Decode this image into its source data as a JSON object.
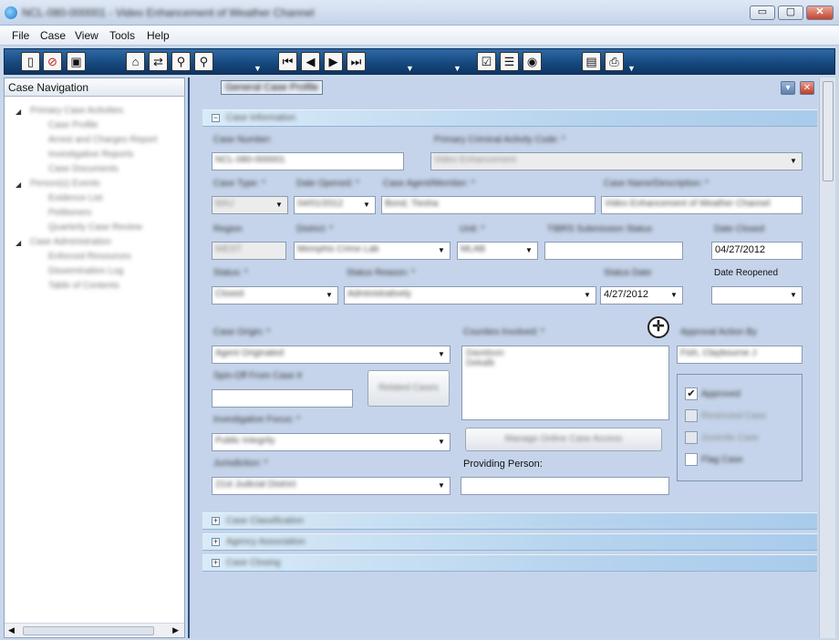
{
  "window": {
    "title": "NCL-080-000001 - Video Enhancement of Weather Channel",
    "buttons": {
      "minimize": "▭",
      "maximize": "▢",
      "close": "✕"
    }
  },
  "menu": {
    "file": "File",
    "case": "Case",
    "view": "View",
    "tools": "Tools",
    "help": "Help"
  },
  "toolbar": {
    "icons": [
      "new-document-icon",
      "stop-icon",
      "save-icon",
      "home-icon",
      "refresh-icon",
      "search-icon",
      "advanced-search-icon",
      "first-record-icon",
      "previous-record-icon",
      "next-record-icon",
      "last-record-icon",
      "checklist-icon",
      "notes-icon",
      "preview-icon",
      "report-icon",
      "print-icon"
    ]
  },
  "sidebar": {
    "title": "Case Navigation",
    "groups": [
      {
        "label": "Primary Case Activities",
        "children": [
          "Case Profile",
          "Arrest and Charges Report",
          "Investigative Reports",
          "Case Documents"
        ]
      },
      {
        "label": "Person(s) Events",
        "children": [
          "Evidence List",
          "Petitioners",
          "Quarterly Case Review"
        ]
      },
      {
        "label": "Case Administration",
        "children": [
          "Enforced Resources",
          "Dissemination Log",
          "Table of Contents"
        ]
      }
    ]
  },
  "panel": {
    "title": "General Case Profile"
  },
  "case_info": {
    "section_title": "Case Information",
    "case_number": {
      "label": "Case Number:",
      "value": "NCL-080-000001"
    },
    "primary_activity": {
      "label": "Primary Criminal Activity Code: *",
      "value": "Video Enhancement"
    },
    "case_type": {
      "label": "Case Type: *",
      "value": "MAJ"
    },
    "date_opened": {
      "label": "Date Opened: *",
      "value": "04/01/2012"
    },
    "case_agent": {
      "label": "Case Agent/Member: *",
      "value": "Bond, Tiesha"
    },
    "case_name": {
      "label": "Case Name/Description: *",
      "value": "Video Enhancement of Weather Channel"
    },
    "region": {
      "label": "Region",
      "value": "WEST"
    },
    "district": {
      "label": "District: *",
      "value": "Memphis Crime Lab"
    },
    "unit": {
      "label": "Unit: *",
      "value": "MLAB"
    },
    "tibrs": {
      "label": "TIBRS Submission Status",
      "value": ""
    },
    "date_closed": {
      "label": "Date Closed",
      "value": "04/27/2012"
    },
    "status": {
      "label": "Status: *",
      "value": "Closed"
    },
    "status_reason": {
      "label": "Status Reason: *",
      "value": "Administratively"
    },
    "status_date": {
      "label": "Status Date",
      "value": "4/27/2012"
    },
    "date_reopened": {
      "label": "Date Reopened",
      "value": ""
    },
    "case_origin": {
      "label": "Case Origin: *",
      "value": "Agent Originated"
    },
    "counties": {
      "label": "Counties Involved: *",
      "values": [
        "Davidson",
        "Dekalb"
      ]
    },
    "approval": {
      "label": "Approval Action By",
      "value": "Fish, Claybourne J"
    },
    "spin_off": {
      "label": "Spin-Off From Case #",
      "value": ""
    },
    "related_cases_button": "Related Cases",
    "focus": {
      "label": "Investigative Focus: *",
      "value": "Public Integrity"
    },
    "manage_access_button": "Manage Online Case Access",
    "jurisdiction": {
      "label": "Jurisdiction: *",
      "value": "21st Judicial District"
    },
    "providing_person": {
      "label": "Providing Person:",
      "value": ""
    },
    "checks": [
      {
        "label": "Approved",
        "checked": "✔"
      },
      {
        "label": "Restricted Case",
        "checked": ""
      },
      {
        "label": "Juvenile Case",
        "checked": ""
      },
      {
        "label": "Flag Case",
        "checked": ""
      }
    ]
  },
  "sections": {
    "classification": "Case Classification",
    "agency": "Agency Association",
    "closing": "Case Closing",
    "expand_symbol": "⊞",
    "collapse_symbol": "⊟"
  },
  "glyphs": {
    "dropdown": "▼",
    "expanded": "◢",
    "scroll_left": "◀",
    "scroll_right": "▶",
    "panel_min": "▾",
    "panel_close": "✕",
    "move_cursor": "✛"
  }
}
